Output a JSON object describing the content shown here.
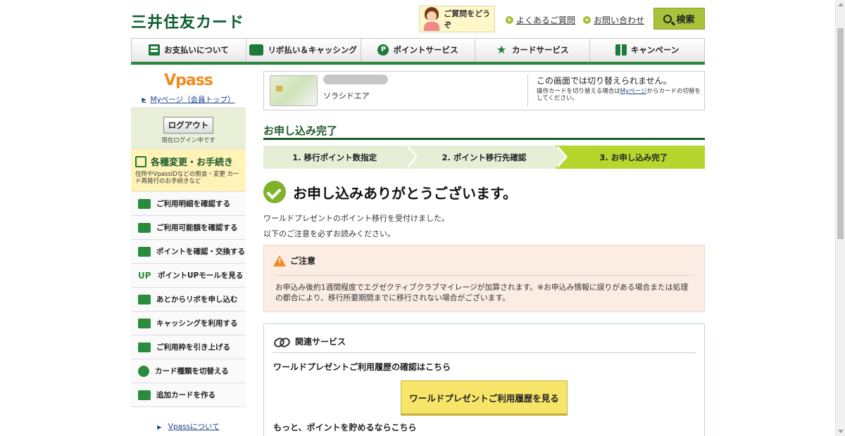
{
  "header": {
    "logo": "三井住友カード",
    "help_label": "ご質問をどうぞ",
    "faq_link": "よくあるご質問",
    "contact_link": "お問い合わせ",
    "search_label": "検索"
  },
  "nav": [
    {
      "label": "お支払いについて",
      "icon": "calculator-icon"
    },
    {
      "label": "リボ払い＆キャッシング",
      "icon": "ribo-icon"
    },
    {
      "label": "ポイントサービス",
      "icon": "point-icon"
    },
    {
      "label": "カードサービス",
      "icon": "star-icon"
    },
    {
      "label": "キャンペーン",
      "icon": "gift-icon"
    }
  ],
  "sidebar": {
    "vpass_logo": "Vpass",
    "mypage_link": "Myページ（会員トップ）",
    "logout_label": "ログアウト",
    "logged_in_text": "現在ログイン中です",
    "settings_title": "各種変更・お手続き",
    "settings_desc": "住所やVpassIDなどの照会・変更 カード再発行のお手続きなど",
    "items": [
      {
        "label": "ご利用明細を確認する",
        "icon": "statement-icon"
      },
      {
        "label": "ご利用可能額を確認する",
        "icon": "card-icon"
      },
      {
        "label": "ポイントを確認・交換する",
        "icon": "point-icon"
      },
      {
        "label": "ポイントUPモールを見る",
        "icon": "up-icon"
      },
      {
        "label": "あとからリボを申し込む",
        "icon": "ribo-icon"
      },
      {
        "label": "キャッシングを利用する",
        "icon": "cash-icon"
      },
      {
        "label": "ご利用枠を引き上げる",
        "icon": "limit-up-icon"
      },
      {
        "label": "カード種類を切替える",
        "icon": "switch-icon"
      },
      {
        "label": "追加カードを作る",
        "icon": "add-card-icon"
      }
    ],
    "footer_link": "Vpassについて"
  },
  "card": {
    "name": "ソラシドエア",
    "note_title": "この画面では切り替えられません。",
    "note_text_before": "操作カードを切り替える場合は",
    "note_link": "Myページ",
    "note_text_after": "からカードの切替をしてください。"
  },
  "main": {
    "page_title": "お申し込み完了",
    "steps": [
      {
        "label": "1. 移行ポイント数指定",
        "active": false
      },
      {
        "label": "2. ポイント移行先確認",
        "active": false
      },
      {
        "label": "3. お申し込み完了",
        "active": true
      }
    ],
    "thanks": "お申し込みありがとうございます。",
    "message1": "ワールドプレゼントのポイント移行を受付けました。",
    "message2": "以下のご注意を必ずお読みください。",
    "caution_title": "ご注意",
    "caution_text": "お申込み後約1週間程度でエグゼクティブクラブマイレージが加算されます。※お申込み情報に誤りがある場合または処理の都合により、移行所要期間までに移行されない場合がございます。",
    "related_title": "関連サービス",
    "related_q1": "ワールドプレゼントご利用履歴の確認はこちら",
    "related_button": "ワールドプレゼントご利用履歴を見る",
    "related_q2": "もっと、ポイントを貯めるならこちら"
  },
  "colors": {
    "brand_green": "#1e5a2a",
    "accent_lime": "#b7d62d",
    "button_yellow": "#f7e56a",
    "caution_bg": "#fcede4"
  }
}
